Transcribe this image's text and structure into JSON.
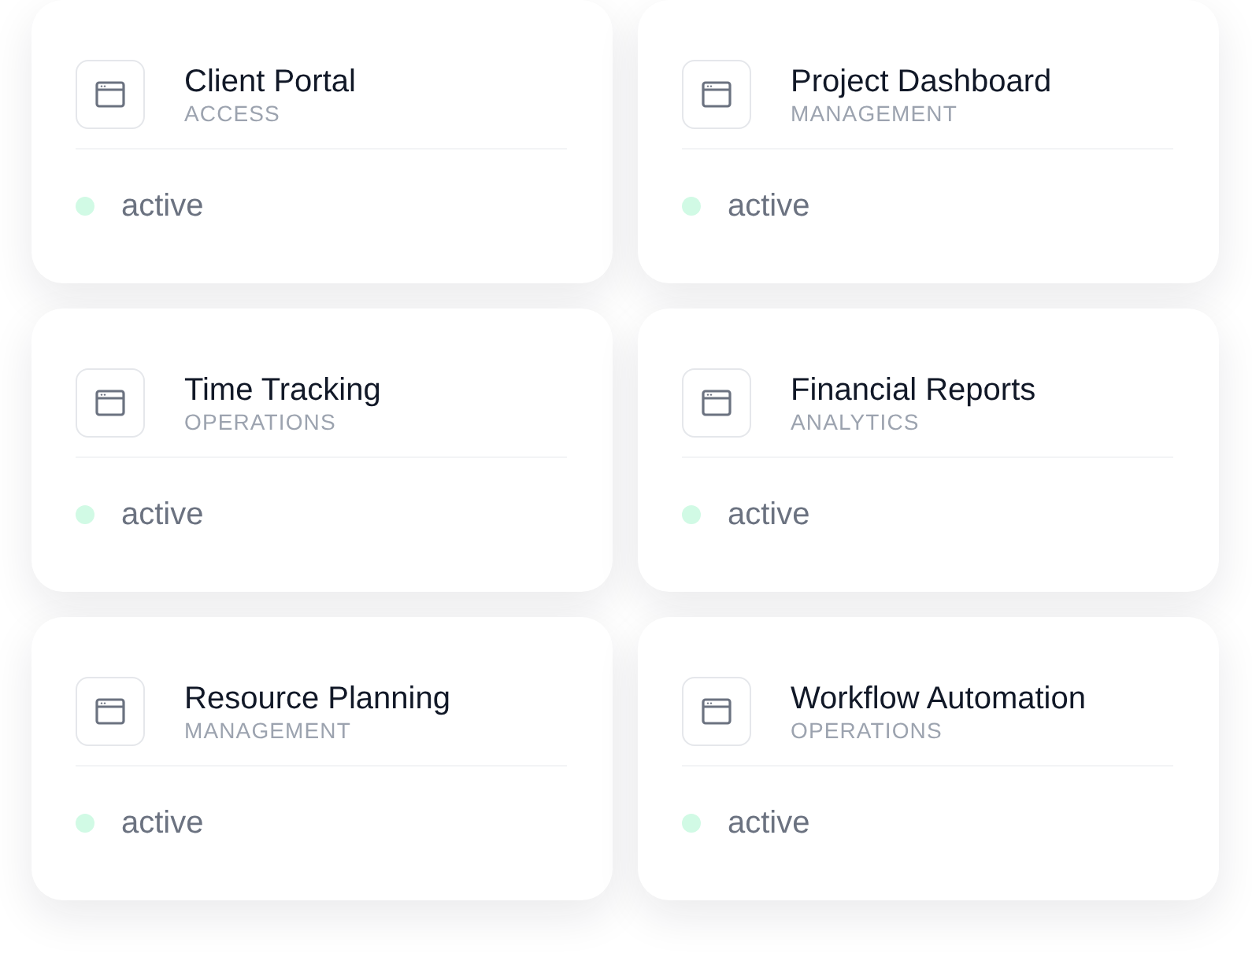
{
  "apps": [
    {
      "title": "Client Portal",
      "category": "ACCESS",
      "status": "active",
      "color": "#d1fae5"
    },
    {
      "title": "Project Dashboard",
      "category": "MANAGEMENT",
      "status": "active",
      "color": "#d1fae5"
    },
    {
      "title": "Time Tracking",
      "category": "OPERATIONS",
      "status": "active",
      "color": "#d1fae5"
    },
    {
      "title": "Financial Reports",
      "category": "ANALYTICS",
      "status": "active",
      "color": "#d1fae5"
    },
    {
      "title": "Resource Planning",
      "category": "MANAGEMENT",
      "status": "active",
      "color": "#d1fae5"
    },
    {
      "title": "Workflow Automation",
      "category": "OPERATIONS",
      "status": "active",
      "color": "#d1fae5"
    }
  ]
}
